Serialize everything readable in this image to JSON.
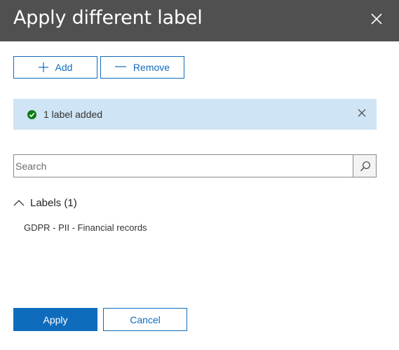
{
  "header": {
    "title": "Apply different label",
    "close_icon": "close-icon"
  },
  "toolbar": {
    "add_label": "Add",
    "add_icon": "plus-icon",
    "remove_label": "Remove",
    "remove_icon": "minus-icon"
  },
  "notification": {
    "message": "1 label added",
    "status_icon": "checkmark-circle-icon",
    "status_color": "#107c10",
    "dismiss_icon": "close-icon",
    "background": "#cfe4f4"
  },
  "search": {
    "placeholder": "Search",
    "value": "",
    "icon": "search-icon"
  },
  "labels_group": {
    "title": "Labels (1)",
    "expanded": true,
    "chevron_icon": "chevron-up-icon",
    "items": [
      {
        "label": "GDPR - PII - Financial records"
      }
    ]
  },
  "footer": {
    "apply_label": "Apply",
    "cancel_label": "Cancel",
    "accent_color": "#0f6cbd"
  }
}
